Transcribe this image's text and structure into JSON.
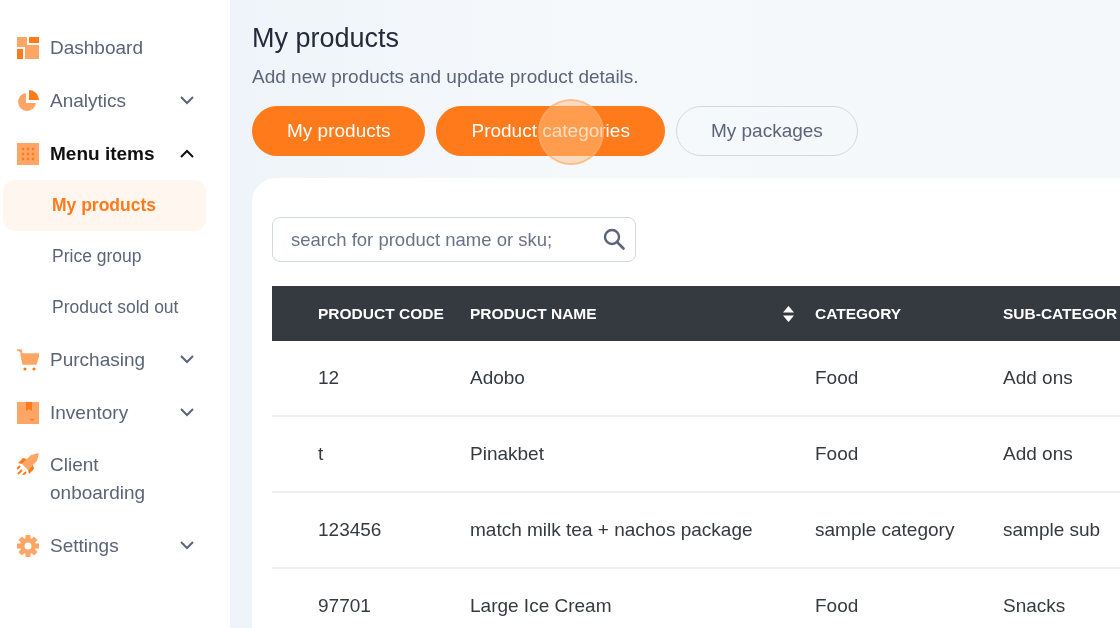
{
  "sidebar": {
    "items": [
      {
        "label": "Dashboard",
        "kind": "link"
      },
      {
        "label": "Analytics",
        "kind": "group",
        "expanded": false
      },
      {
        "label": "Menu items",
        "kind": "group",
        "expanded": true,
        "children": [
          {
            "label": "My products",
            "selected": true
          },
          {
            "label": "Price group",
            "selected": false
          },
          {
            "label": "Product sold out",
            "selected": false
          }
        ]
      },
      {
        "label": "Purchasing",
        "kind": "group",
        "expanded": false
      },
      {
        "label": "Inventory",
        "kind": "group",
        "expanded": false
      },
      {
        "label": "Client onboarding",
        "kind": "link"
      },
      {
        "label": "Settings",
        "kind": "group",
        "expanded": false
      }
    ]
  },
  "page": {
    "title": "My products",
    "subtitle": "Add new products and update product details."
  },
  "tabs": [
    {
      "label": "My products",
      "selected": true
    },
    {
      "label": "Product categories",
      "selected": true
    },
    {
      "label": "My packages",
      "selected": false
    }
  ],
  "search": {
    "placeholder": "search for product name or sku;"
  },
  "table": {
    "columns": [
      "PRODUCT CODE",
      "PRODUCT NAME",
      "CATEGORY",
      "SUB-CATEGOR"
    ],
    "rows": [
      [
        "12",
        "Adobo",
        "Food",
        "Add ons"
      ],
      [
        "t",
        "Pinakbet",
        "Food",
        "Add ons"
      ],
      [
        "123456",
        "match milk tea + nachos package",
        "sample category",
        "sample sub"
      ],
      [
        "97701",
        "Large Ice Cream",
        "Food",
        "Snacks"
      ]
    ]
  }
}
